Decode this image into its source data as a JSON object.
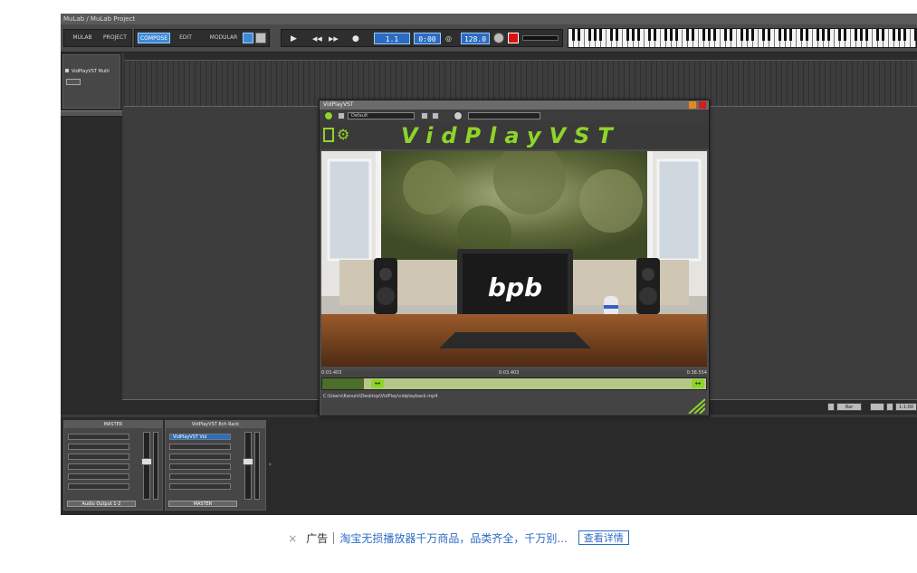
{
  "window": {
    "title": "MuLab / MuLab Project"
  },
  "toolbar": {
    "tabs": [
      {
        "label": "MULAB",
        "active": false
      },
      {
        "label": "PROJECT",
        "active": false
      },
      {
        "label": "COMPOSE",
        "active": true
      },
      {
        "label": "EDIT",
        "active": false
      },
      {
        "label": "MODULAR",
        "active": false
      }
    ],
    "position": "1.1",
    "time": "0:00",
    "tempo": "128.0"
  },
  "tracks": [
    {
      "label": "VidPlayVST Multi"
    }
  ],
  "seq_controls": {
    "right_readout": "1:1:00",
    "mode": "Bar"
  },
  "mixer": {
    "strips": [
      {
        "title": "MASTER",
        "footer": "Audio Output 1-2"
      },
      {
        "title": "VidPlayVST 8ch Rack",
        "slot": "VidPlayVST Vid",
        "footer": "MASTER"
      }
    ]
  },
  "plugin": {
    "title": "VidPlayVST",
    "preset": "Default",
    "logo": "VidPlayVST",
    "video_label": "bpb",
    "time_start": "0:03.403",
    "time_mid": "0:03.403",
    "time_end": "0:38.554",
    "file_path": "C:\\Users\\Kanuni\\Desktop\\VidPlay\\vidplayback.mp4"
  },
  "ad": {
    "close": "×",
    "tag": "广告",
    "text": "淘宝无损播放器千万商品，品类齐全，千万别...",
    "button": "查看详情"
  },
  "colors": {
    "accent": "#8fd42a",
    "active_tab": "#3d8ad8",
    "link": "#2d6cc5"
  }
}
